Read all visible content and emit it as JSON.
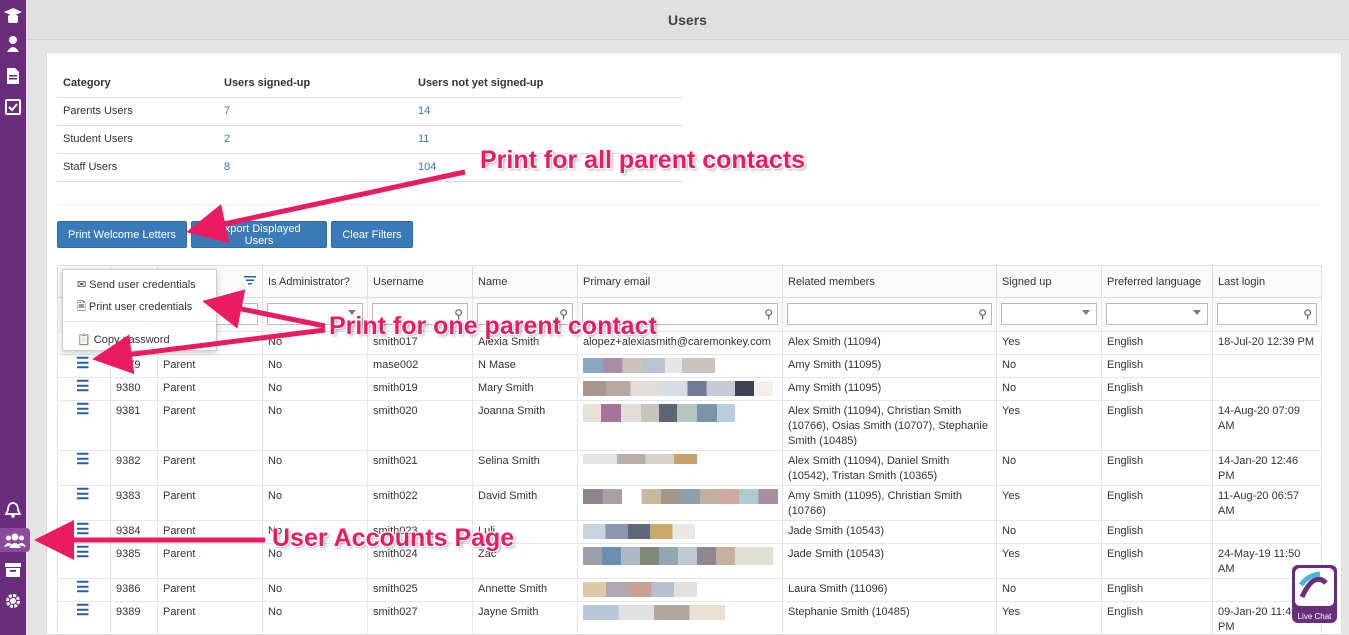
{
  "page": {
    "title": "Users"
  },
  "sidebar": {
    "top_icons": [
      "graduate-icon",
      "user-icon",
      "document-icon",
      "calendar-check-icon"
    ],
    "bottom_icons": [
      "bell-icon",
      "users-icon",
      "archive-icon",
      "gear-icon"
    ]
  },
  "summary": {
    "headers": [
      "Category",
      "Users signed-up",
      "Users not yet signed-up"
    ],
    "rows": [
      {
        "category": "Parents Users",
        "signed": "7",
        "not_signed": "14"
      },
      {
        "category": "Student Users",
        "signed": "2",
        "not_signed": "11"
      },
      {
        "category": "Staff Users",
        "signed": "8",
        "not_signed": "104"
      }
    ]
  },
  "buttons": {
    "print": "Print Welcome Letters",
    "export": "Export Displayed Users",
    "clear": "Clear Filters"
  },
  "grid": {
    "headers": [
      "Is Administrator?",
      "Username",
      "Name",
      "Primary email",
      "Related members",
      "Signed up",
      "Preferred language",
      "Last login"
    ],
    "first_row": {
      "admin": "No",
      "username": "smith017",
      "name": "Alexia Smith",
      "email": "alopez+alexiasmith@caremonkey.com",
      "related": "Alex Smith (11094)",
      "signed": "Yes",
      "lang": "English",
      "last": "18-Jul-20 12:39 PM"
    },
    "rows": [
      {
        "id": "9379",
        "type": "Parent",
        "admin": "No",
        "username": "mase002",
        "name": "N Mase",
        "related": "Amy Smith (11095)",
        "signed": "No",
        "lang": "English",
        "last": ""
      },
      {
        "id": "9380",
        "type": "Parent",
        "admin": "No",
        "username": "smith019",
        "name": "Mary Smith",
        "related": "Amy Smith (11095)",
        "signed": "No",
        "lang": "English",
        "last": ""
      },
      {
        "id": "9381",
        "type": "Parent",
        "admin": "No",
        "username": "smith020",
        "name": "Joanna Smith",
        "related": "Alex Smith (11094), Christian Smith (10766), Osias Smith (10707), Stephanie Smith (10485)",
        "signed": "Yes",
        "lang": "English",
        "last": "14-Aug-20 07:09 AM"
      },
      {
        "id": "9382",
        "type": "Parent",
        "admin": "No",
        "username": "smith021",
        "name": "Selina Smith",
        "related": "Alex Smith (11094), Daniel Smith (10542), Tristan Smith (10365)",
        "signed": "No",
        "lang": "English",
        "last": "14-Jan-20 12:46 PM"
      },
      {
        "id": "9383",
        "type": "Parent",
        "admin": "No",
        "username": "smith022",
        "name": "David Smith",
        "related": "Amy Smith (11095), Christian Smith (10766)",
        "signed": "Yes",
        "lang": "English",
        "last": "11-Aug-20 06:57 AM"
      },
      {
        "id": "9384",
        "type": "Parent",
        "admin": "No",
        "username": "smith023",
        "name": "Luli",
        "related": "Jade Smith (10543)",
        "signed": "No",
        "lang": "English",
        "last": ""
      },
      {
        "id": "9385",
        "type": "Parent",
        "admin": "No",
        "username": "smith024",
        "name": "Zac",
        "related": "Jade Smith (10543)",
        "signed": "Yes",
        "lang": "English",
        "last": "24-May-19 11:50 AM"
      },
      {
        "id": "9386",
        "type": "Parent",
        "admin": "No",
        "username": "smith025",
        "name": "Annette Smith",
        "related": "Laura Smith (11096)",
        "signed": "No",
        "lang": "English",
        "last": ""
      },
      {
        "id": "9389",
        "type": "Parent",
        "admin": "No",
        "username": "smith027",
        "name": "Jayne Smith",
        "related": "Stephanie Smith (10485)",
        "signed": "Yes",
        "lang": "English",
        "last": "09-Jan-20 11:45 PM"
      }
    ]
  },
  "context_menu": {
    "send": "Send user credentials",
    "print": "Print user credentials",
    "copy": "Copy password"
  },
  "annotations": {
    "all": "Print for all parent contacts",
    "one": "Print for one parent contact",
    "accounts": "User Accounts Page"
  },
  "colors": {
    "annotation": "#ea1b60",
    "sidebar": "#6a2d7c",
    "button": "#3a7ab8",
    "link": "#337ab7"
  },
  "chat": {
    "label": "Live Chat"
  }
}
